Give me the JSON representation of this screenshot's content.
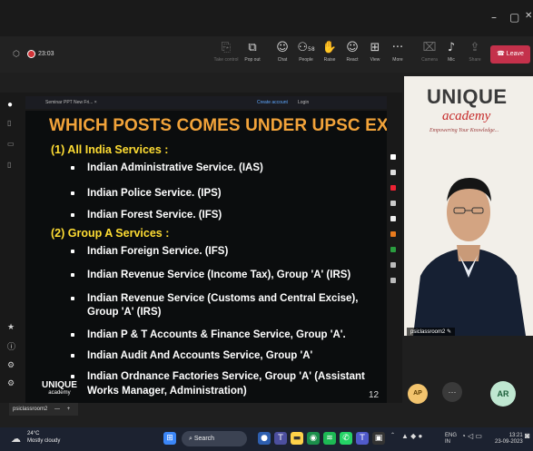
{
  "window": {
    "minimize": "–",
    "maximize": "▢",
    "close": "✕"
  },
  "toolbar": {
    "meeting_time": "23:03",
    "take_control": "Take control",
    "pop_out": "Pop out",
    "chat": "Chat",
    "people": "People",
    "people_count": "58",
    "raise": "Raise",
    "react": "React",
    "view": "View",
    "more": "More",
    "camera": "Camera",
    "mic": "Mic",
    "share": "Share",
    "leave": "Leave"
  },
  "ppt": {
    "tab_title": "Seminar PPT New Fri... ×",
    "create_account": "Create account",
    "login": "Login"
  },
  "slide": {
    "title": "WHICH POSTS COMES UNDER UPSC EXAMS ?",
    "section1": "(1)  All India Services :",
    "section1_items": [
      "Indian Administrative Service. (IAS)",
      "Indian Police Service. (IPS)",
      "Indian Forest Service. (IFS)"
    ],
    "section2": "(2)  Group A Services :",
    "section2_items": [
      "Indian Foreign Service. (IFS)",
      "Indian Revenue Service (Income Tax), Group 'A' (IRS)",
      "Indian Revenue Service (Customs and Central Excise),",
      "Group 'A' (IRS)",
      "Indian P & T Accounts & Finance Service, Group 'A'.",
      "Indian Audit And Accounts Service, Group 'A'",
      "Indian Ordnance Factories Service, Group 'A' (Assistant",
      "Works Manager, Administration)"
    ],
    "page_number": "12",
    "logo_line1": "UNIQUE",
    "logo_line2": "academy"
  },
  "left_controls": {
    "room_name": "psiclassroom2",
    "minus": "—",
    "plus": "+"
  },
  "video": {
    "logo_line1": "UNIQUE",
    "logo_line2": "academy",
    "tagline": "Empowering Your Knowledge...",
    "name_tag": "psiclassroom2"
  },
  "participants": {
    "ap_initials": "AP",
    "ar_initials": "AR",
    "more": "···"
  },
  "taskbar": {
    "temperature": "24°C",
    "weather": "Mostly cloudy",
    "search": "Search",
    "lang_top": "ENG",
    "lang_bottom": "IN",
    "clock_time": "13:21",
    "clock_date": "23-09-2023"
  }
}
